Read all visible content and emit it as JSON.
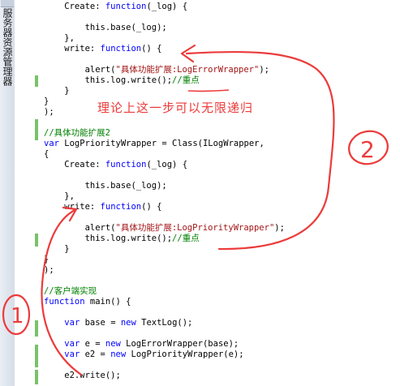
{
  "sidebar": {
    "tab_label": "服务器资源管理器"
  },
  "code_lines": [
    [
      "    Create: ",
      {
        "k": "function"
      },
      "(_log) {"
    ],
    [
      ""
    ],
    [
      "        this.base(_log);"
    ],
    [
      "    },"
    ],
    [
      "    write: ",
      {
        "k": "function"
      },
      "() {"
    ],
    [
      ""
    ],
    [
      "        alert(",
      {
        "s": "\"具体功能扩展:LogErrorWrapper\""
      },
      ");"
    ],
    [
      "        this.log.write();",
      {
        "c": "//重点"
      }
    ],
    [
      "    }"
    ],
    [
      "}"
    ],
    [
      ");"
    ],
    [
      ""
    ],
    [
      {
        "c": "//具体功能扩展2"
      }
    ],
    [
      {
        "k": "var"
      },
      " LogPriorityWrapper = Class(ILogWrapper,"
    ],
    [
      "{"
    ],
    [
      "    Create: ",
      {
        "k": "function"
      },
      "(_log) {"
    ],
    [
      ""
    ],
    [
      "        this.base(_log);"
    ],
    [
      "    },"
    ],
    [
      "    write: ",
      {
        "k": "function"
      },
      "() {"
    ],
    [
      ""
    ],
    [
      "        alert(",
      {
        "s": "\"具体功能扩展:LogPriorityWrapper\""
      },
      ");"
    ],
    [
      "        this.log.write();",
      {
        "c": "//重点"
      }
    ],
    [
      "    }"
    ],
    [
      "}"
    ],
    [
      ");"
    ],
    [
      ""
    ],
    [
      {
        "c": "//客户端实现"
      }
    ],
    [
      {
        "k": "function"
      },
      " main() {"
    ],
    [
      ""
    ],
    [
      "    ",
      {
        "k": "var"
      },
      " base = ",
      {
        "k": "new"
      },
      " TextLog();"
    ],
    [
      ""
    ],
    [
      "    ",
      {
        "k": "var"
      },
      " e = ",
      {
        "k": "new"
      },
      " LogErrorWrapper(base);"
    ],
    [
      "    ",
      {
        "k": "var"
      },
      " e2 = ",
      {
        "k": "new"
      },
      " LogPriorityWrapper(e);"
    ],
    [
      ""
    ],
    [
      "    e2.write();"
    ]
  ],
  "annotation": {
    "note_text": "理论上这一步可以无限递归",
    "circle_1_label": "1",
    "circle_2_label": "2",
    "ink_color": "#ec3b3b"
  }
}
